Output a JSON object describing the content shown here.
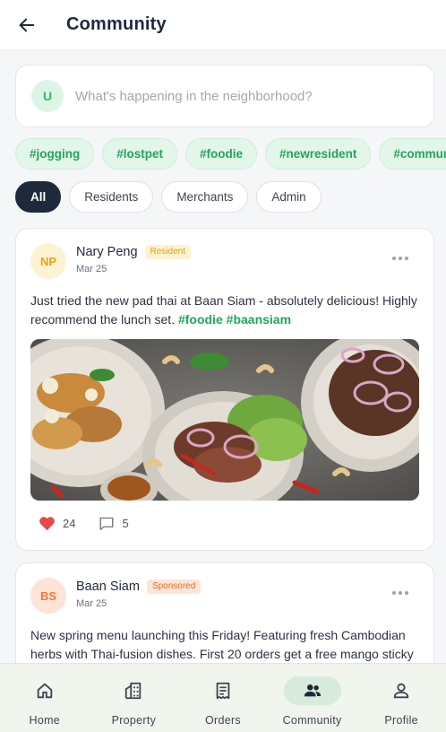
{
  "header": {
    "title": "Community",
    "back_icon": "arrow-left-icon"
  },
  "composer": {
    "avatar_initial": "U",
    "placeholder": "What's happening in the neighborhood?"
  },
  "tags": [
    "#jogging",
    "#lostpet",
    "#foodie",
    "#newresident",
    "#community"
  ],
  "filters": [
    {
      "label": "All",
      "active": true
    },
    {
      "label": "Residents",
      "active": false
    },
    {
      "label": "Merchants",
      "active": false
    },
    {
      "label": "Admin",
      "active": false
    }
  ],
  "posts": [
    {
      "initials": "NP",
      "author": "Nary Peng",
      "badge": "Resident",
      "date": "Mar 25",
      "text": "Just tried the new pad thai at Baan Siam - absolutely delicious! Highly recommend the lunch set.",
      "hashtags": "#foodie #baansiam",
      "likes": "24",
      "comments": "5"
    },
    {
      "initials": "BS",
      "author": "Baan Siam",
      "badge": "Sponsored",
      "date": "Mar 25",
      "text": "New spring menu launching this Friday! Featuring fresh Cambodian herbs with Thai-fusion dishes. First 20 orders get a free mango sticky"
    }
  ],
  "nav": [
    {
      "label": "Home",
      "icon": "home-icon",
      "active": false
    },
    {
      "label": "Property",
      "icon": "buildings-icon",
      "active": false
    },
    {
      "label": "Orders",
      "icon": "receipt-icon",
      "active": false
    },
    {
      "label": "Community",
      "icon": "people-icon",
      "active": true
    },
    {
      "label": "Profile",
      "icon": "person-icon",
      "active": false
    }
  ],
  "colors": {
    "accent_green": "#22a559",
    "dark": "#1e2a3b",
    "like_red": "#e5484d"
  }
}
